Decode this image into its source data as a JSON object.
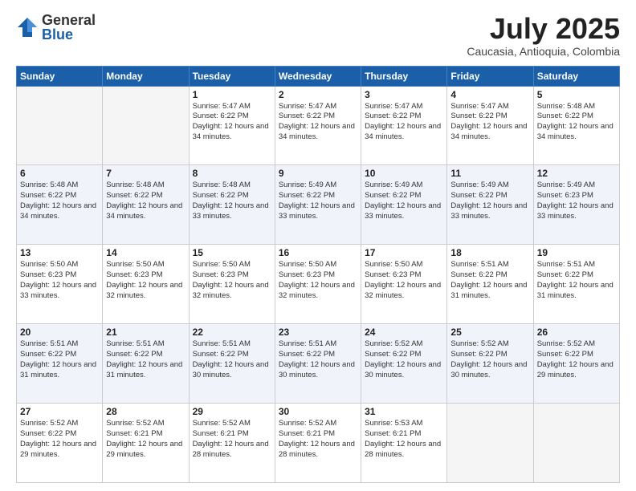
{
  "logo": {
    "general": "General",
    "blue": "Blue"
  },
  "title": "July 2025",
  "subtitle": "Caucasia, Antioquia, Colombia",
  "weekdays": [
    "Sunday",
    "Monday",
    "Tuesday",
    "Wednesday",
    "Thursday",
    "Friday",
    "Saturday"
  ],
  "weeks": [
    [
      {
        "day": "",
        "info": ""
      },
      {
        "day": "",
        "info": ""
      },
      {
        "day": "1",
        "info": "Sunrise: 5:47 AM\nSunset: 6:22 PM\nDaylight: 12 hours\nand 34 minutes."
      },
      {
        "day": "2",
        "info": "Sunrise: 5:47 AM\nSunset: 6:22 PM\nDaylight: 12 hours\nand 34 minutes."
      },
      {
        "day": "3",
        "info": "Sunrise: 5:47 AM\nSunset: 6:22 PM\nDaylight: 12 hours\nand 34 minutes."
      },
      {
        "day": "4",
        "info": "Sunrise: 5:47 AM\nSunset: 6:22 PM\nDaylight: 12 hours\nand 34 minutes."
      },
      {
        "day": "5",
        "info": "Sunrise: 5:48 AM\nSunset: 6:22 PM\nDaylight: 12 hours\nand 34 minutes."
      }
    ],
    [
      {
        "day": "6",
        "info": "Sunrise: 5:48 AM\nSunset: 6:22 PM\nDaylight: 12 hours\nand 34 minutes."
      },
      {
        "day": "7",
        "info": "Sunrise: 5:48 AM\nSunset: 6:22 PM\nDaylight: 12 hours\nand 34 minutes."
      },
      {
        "day": "8",
        "info": "Sunrise: 5:48 AM\nSunset: 6:22 PM\nDaylight: 12 hours\nand 33 minutes."
      },
      {
        "day": "9",
        "info": "Sunrise: 5:49 AM\nSunset: 6:22 PM\nDaylight: 12 hours\nand 33 minutes."
      },
      {
        "day": "10",
        "info": "Sunrise: 5:49 AM\nSunset: 6:22 PM\nDaylight: 12 hours\nand 33 minutes."
      },
      {
        "day": "11",
        "info": "Sunrise: 5:49 AM\nSunset: 6:22 PM\nDaylight: 12 hours\nand 33 minutes."
      },
      {
        "day": "12",
        "info": "Sunrise: 5:49 AM\nSunset: 6:23 PM\nDaylight: 12 hours\nand 33 minutes."
      }
    ],
    [
      {
        "day": "13",
        "info": "Sunrise: 5:50 AM\nSunset: 6:23 PM\nDaylight: 12 hours\nand 33 minutes."
      },
      {
        "day": "14",
        "info": "Sunrise: 5:50 AM\nSunset: 6:23 PM\nDaylight: 12 hours\nand 32 minutes."
      },
      {
        "day": "15",
        "info": "Sunrise: 5:50 AM\nSunset: 6:23 PM\nDaylight: 12 hours\nand 32 minutes."
      },
      {
        "day": "16",
        "info": "Sunrise: 5:50 AM\nSunset: 6:23 PM\nDaylight: 12 hours\nand 32 minutes."
      },
      {
        "day": "17",
        "info": "Sunrise: 5:50 AM\nSunset: 6:23 PM\nDaylight: 12 hours\nand 32 minutes."
      },
      {
        "day": "18",
        "info": "Sunrise: 5:51 AM\nSunset: 6:22 PM\nDaylight: 12 hours\nand 31 minutes."
      },
      {
        "day": "19",
        "info": "Sunrise: 5:51 AM\nSunset: 6:22 PM\nDaylight: 12 hours\nand 31 minutes."
      }
    ],
    [
      {
        "day": "20",
        "info": "Sunrise: 5:51 AM\nSunset: 6:22 PM\nDaylight: 12 hours\nand 31 minutes."
      },
      {
        "day": "21",
        "info": "Sunrise: 5:51 AM\nSunset: 6:22 PM\nDaylight: 12 hours\nand 31 minutes."
      },
      {
        "day": "22",
        "info": "Sunrise: 5:51 AM\nSunset: 6:22 PM\nDaylight: 12 hours\nand 30 minutes."
      },
      {
        "day": "23",
        "info": "Sunrise: 5:51 AM\nSunset: 6:22 PM\nDaylight: 12 hours\nand 30 minutes."
      },
      {
        "day": "24",
        "info": "Sunrise: 5:52 AM\nSunset: 6:22 PM\nDaylight: 12 hours\nand 30 minutes."
      },
      {
        "day": "25",
        "info": "Sunrise: 5:52 AM\nSunset: 6:22 PM\nDaylight: 12 hours\nand 30 minutes."
      },
      {
        "day": "26",
        "info": "Sunrise: 5:52 AM\nSunset: 6:22 PM\nDaylight: 12 hours\nand 29 minutes."
      }
    ],
    [
      {
        "day": "27",
        "info": "Sunrise: 5:52 AM\nSunset: 6:22 PM\nDaylight: 12 hours\nand 29 minutes."
      },
      {
        "day": "28",
        "info": "Sunrise: 5:52 AM\nSunset: 6:21 PM\nDaylight: 12 hours\nand 29 minutes."
      },
      {
        "day": "29",
        "info": "Sunrise: 5:52 AM\nSunset: 6:21 PM\nDaylight: 12 hours\nand 28 minutes."
      },
      {
        "day": "30",
        "info": "Sunrise: 5:52 AM\nSunset: 6:21 PM\nDaylight: 12 hours\nand 28 minutes."
      },
      {
        "day": "31",
        "info": "Sunrise: 5:53 AM\nSunset: 6:21 PM\nDaylight: 12 hours\nand 28 minutes."
      },
      {
        "day": "",
        "info": ""
      },
      {
        "day": "",
        "info": ""
      }
    ]
  ]
}
